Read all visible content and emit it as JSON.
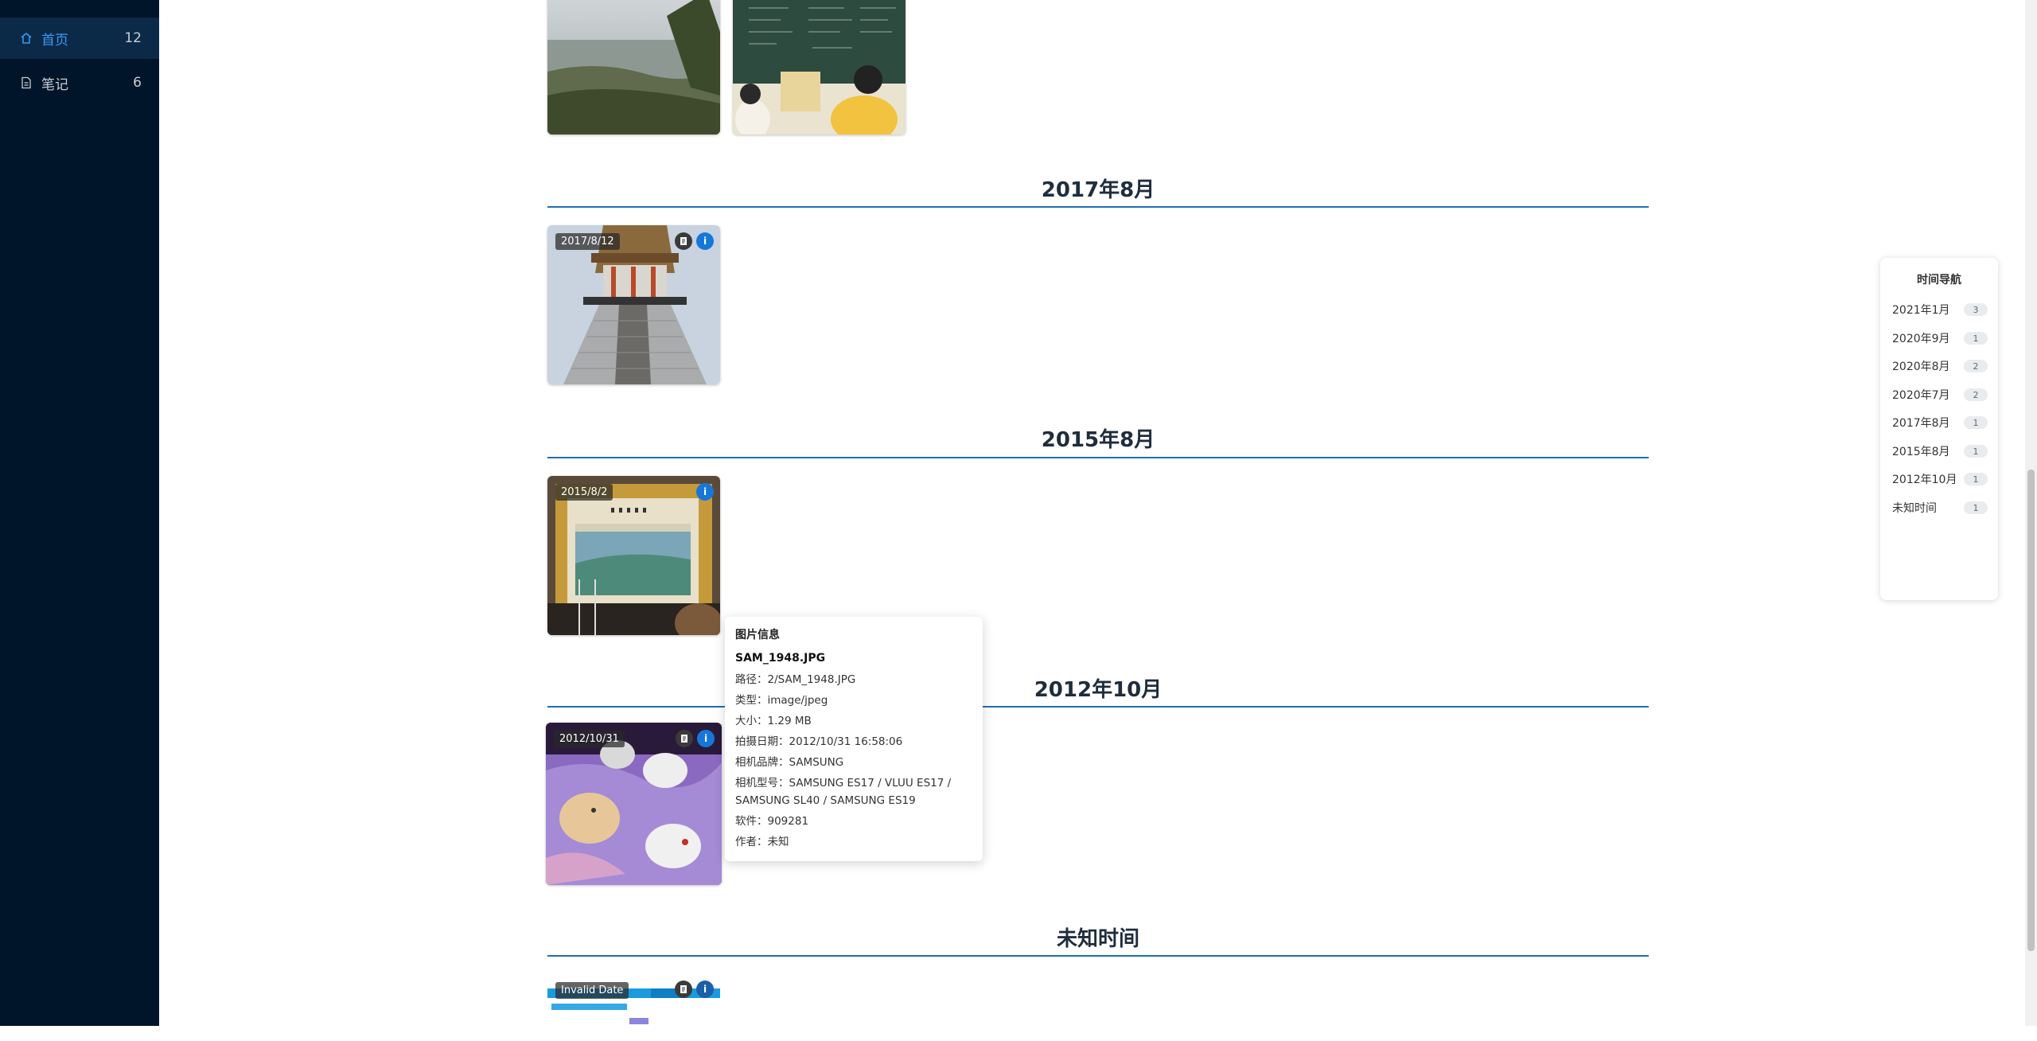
{
  "sidebar": {
    "items": [
      {
        "label": "首页",
        "count": "12",
        "icon": "home-icon",
        "active": true
      },
      {
        "label": "笔记",
        "count": "6",
        "icon": "document-icon",
        "active": false
      }
    ]
  },
  "sections": [
    {
      "title": "2017年8月",
      "photos": [
        {
          "date": "2017/8/12"
        }
      ]
    },
    {
      "title": "2015年8月",
      "photos": [
        {
          "date": "2015/8/2"
        }
      ]
    },
    {
      "title": "2012年10月",
      "photos": [
        {
          "date": "2012/10/31"
        }
      ]
    },
    {
      "title": "未知时间",
      "photos": [
        {
          "date": "Invalid Date"
        }
      ]
    }
  ],
  "tooltip": {
    "title": "图片信息",
    "filename": "SAM_1948.JPG",
    "path": "路径：2/SAM_1948.JPG",
    "type": "类型：image/jpeg",
    "size": "大小：1.29 MB",
    "date": "拍摄日期：2012/10/31 16:58:06",
    "brand": "相机品牌：SAMSUNG",
    "model": "相机型号：SAMSUNG ES17 / VLUU ES17 / SAMSUNG SL40 / SAMSUNG ES19",
    "software": "软件：909281",
    "author": "作者：未知"
  },
  "time_nav": {
    "title": "时间导航",
    "items": [
      {
        "label": "2021年1月",
        "count": "3"
      },
      {
        "label": "2020年9月",
        "count": "1"
      },
      {
        "label": "2020年8月",
        "count": "2"
      },
      {
        "label": "2020年7月",
        "count": "2"
      },
      {
        "label": "2017年8月",
        "count": "1"
      },
      {
        "label": "2015年8月",
        "count": "1"
      },
      {
        "label": "2012年10月",
        "count": "1"
      },
      {
        "label": "未知时间",
        "count": "1"
      }
    ]
  }
}
